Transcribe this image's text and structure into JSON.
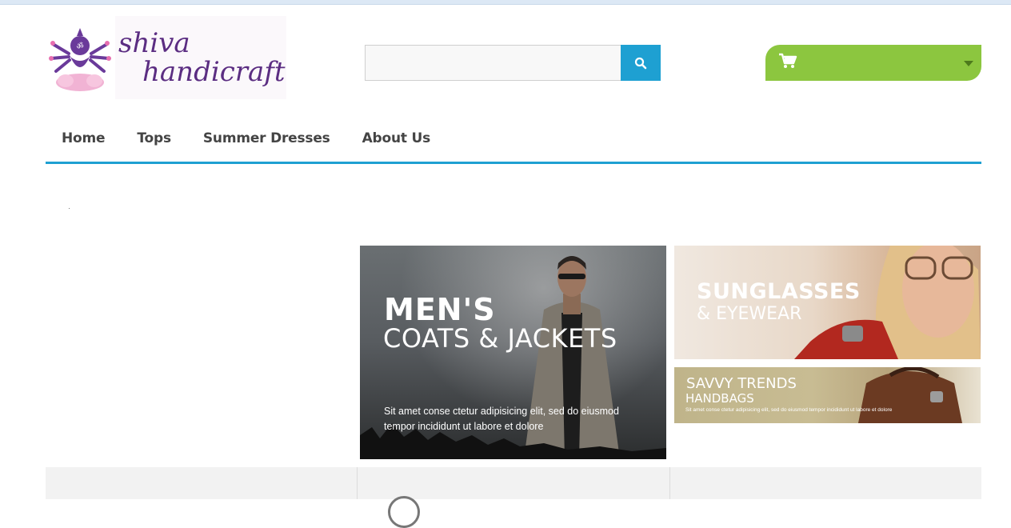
{
  "logo": {
    "line1": "shiva",
    "line2": "handicraft"
  },
  "search": {
    "placeholder": "",
    "value": ""
  },
  "cart": {
    "icon": "shopping-cart-icon"
  },
  "nav": {
    "items": [
      "Home",
      "Tops",
      "Summer Dresses",
      "About Us"
    ]
  },
  "banners": {
    "men": {
      "title": "MEN'S",
      "subtitle": "COATS & JACKETS",
      "text": "Sit amet conse ctetur adipisicing elit, sed do eiusmod tempor incididunt ut labore et dolore"
    },
    "sunglasses": {
      "title": "SUNGLASSES",
      "subtitle": "& EYEWEAR"
    },
    "handbags": {
      "title": "SAVVY TRENDS",
      "subtitle": "HANDBAGS",
      "text": "Sit amet conse ctetur adipisicing elit, sed do eiusmod tempor incididunt ut labore et dolore"
    }
  },
  "colors": {
    "accent": "#1ea0d2",
    "cart": "#8cc63f",
    "brand": "#5b2d82"
  }
}
